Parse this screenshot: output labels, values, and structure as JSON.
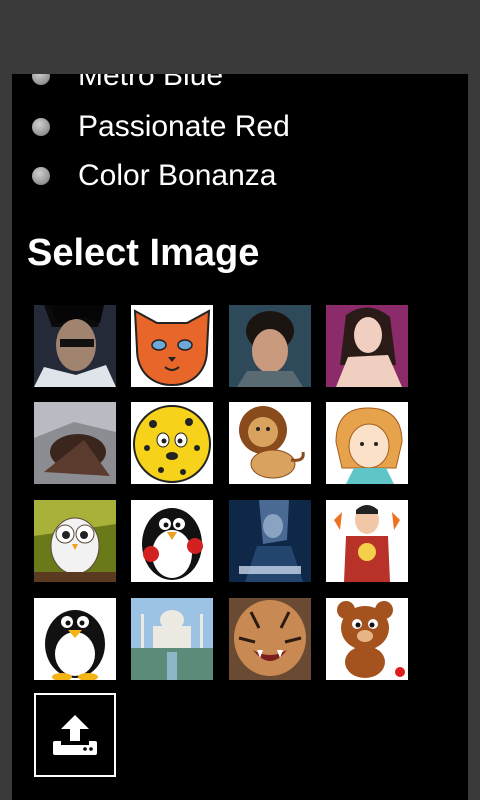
{
  "toolbar": {
    "buttons": [
      {
        "icon": "gears-icon",
        "active": true
      },
      {
        "icon": "image-icon",
        "active": false
      },
      {
        "icon": "bar-chart-icon",
        "active": false
      },
      {
        "icon": "user-icon",
        "active": false
      },
      {
        "icon": "help-icon",
        "label": "?",
        "active": false
      }
    ]
  },
  "themes": {
    "options": [
      {
        "label": "Metro Blue"
      },
      {
        "label": "Passionate Red"
      },
      {
        "label": "Color Bonanza"
      }
    ]
  },
  "select_image": {
    "title": "Select Image",
    "images": [
      {
        "name": "man-portrait"
      },
      {
        "name": "cat-face"
      },
      {
        "name": "boy-portrait"
      },
      {
        "name": "woman-portrait"
      },
      {
        "name": "bird-photo"
      },
      {
        "name": "leopard-face"
      },
      {
        "name": "lion-cartoon"
      },
      {
        "name": "girl-cartoon"
      },
      {
        "name": "owl-cartoon"
      },
      {
        "name": "penguin-with-roses"
      },
      {
        "name": "ra-one-poster"
      },
      {
        "name": "superhero-cartoon"
      },
      {
        "name": "penguin-cartoon"
      },
      {
        "name": "taj-mahal"
      },
      {
        "name": "tiger-photo"
      },
      {
        "name": "bear-cartoon"
      }
    ],
    "upload_icon": "upload-icon"
  },
  "colors": {
    "background": "#000000",
    "frame": "#3a3a3a",
    "text": "#ffffff"
  }
}
